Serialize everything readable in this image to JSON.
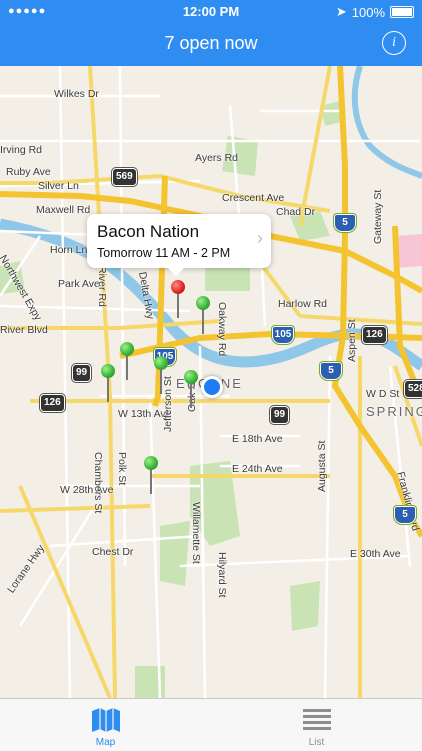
{
  "status": {
    "time": "12:00 PM",
    "battery": "100%",
    "signal": "●●●●●"
  },
  "header": {
    "title": "7 open now",
    "info_label": "i"
  },
  "callout": {
    "name": "Bacon Nation",
    "hours": "Tomorrow 11 AM - 2 PM"
  },
  "map": {
    "streets": [
      "Wilkes Dr",
      "Irving Rd",
      "Ruby Ave",
      "Silver Ln",
      "Maxwell Rd",
      "Horn Ln",
      "Park Ave",
      "Northwest Expy",
      "W 13th Ave",
      "W 28th Ave",
      "Chest Dr",
      "Lorane Hwy",
      "E 18th Ave",
      "E 24th Ave",
      "E 30th Ave",
      "Ayers Rd",
      "Crescent Ave",
      "Chad Dr",
      "Harlow Rd",
      "Oakway Rd",
      "Gateway St",
      "Aspen St",
      "Augusta St",
      "Franklin Blvd",
      "Hilyard St",
      "Willamette St",
      "Jefferson St",
      "Polk St",
      "Chambers St",
      "Oak St",
      "River Rd",
      "W D St",
      "Delta Hwy",
      "Beltline Rd",
      "River Blvd"
    ],
    "place_labels": [
      "SPRINGFIELD",
      "EUGENE"
    ],
    "shields": [
      "569",
      "99",
      "126",
      "99",
      "5",
      "105",
      "105",
      "126",
      "5",
      "5",
      "528"
    ]
  },
  "tabs": [
    {
      "label": "Map"
    },
    {
      "label": "List"
    }
  ]
}
